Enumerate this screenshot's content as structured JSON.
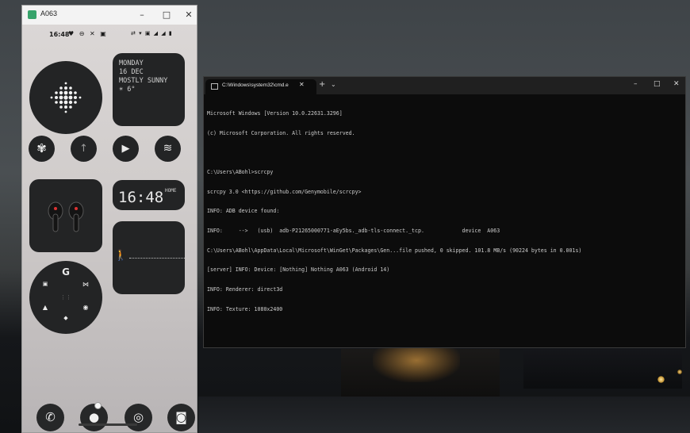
{
  "phone_window": {
    "title": "A063",
    "controls": {
      "minimize": "–",
      "maximize": "□",
      "close": "✕"
    },
    "status": {
      "time": "16:48",
      "left_icons": "♥ ⊖ ✕ ▣",
      "right_icons": "⇄ ▾ ▣ ◢ ◢ ▮"
    },
    "weather": {
      "day": "MONDAY",
      "date": "16 DEC",
      "condition": "MOSTLY SUNNY",
      "temp": "☀ 6°"
    },
    "clock": {
      "time": "16:48",
      "label": "HOME"
    },
    "app_row": [
      "✾",
      "↑",
      "▶",
      "≋"
    ],
    "google_cluster": {
      "center": "G",
      "icons": [
        "▣",
        "⋈",
        "⋮⋮",
        "▲",
        "◉",
        "◆"
      ]
    },
    "dock": [
      "✆",
      "●",
      "◎",
      "◙"
    ]
  },
  "terminal": {
    "tab_title": "C:\\Windows\\system32\\cmd.e",
    "tab_close": "✕",
    "new_tab": "+",
    "dropdown": "⌄",
    "controls": {
      "minimize": "–",
      "maximize": "□",
      "close": "✕"
    },
    "lines": [
      "Microsoft Windows [Version 10.0.22631.3296]",
      "(c) Microsoft Corporation. All rights reserved.",
      "",
      "C:\\Users\\ABohl>scrcpy",
      "scrcpy 3.0 <https://github.com/Genymobile/scrcpy>",
      "INFO: ADB device found:",
      "INFO:     -->   (usb)  adb-P21265000771-aEy5bs._adb-tls-connect._tcp.            device  A063",
      "C:\\Users\\ABohl\\AppData\\Local\\Microsoft\\WinGet\\Packages\\Gen...file pushed, 0 skipped. 101.8 MB/s (90224 bytes in 0.001s)",
      "[server] INFO: Device: [Nothing] Nothing A063 (Android 14)",
      "INFO: Renderer: direct3d",
      "INFO: Texture: 1080x2400"
    ]
  }
}
